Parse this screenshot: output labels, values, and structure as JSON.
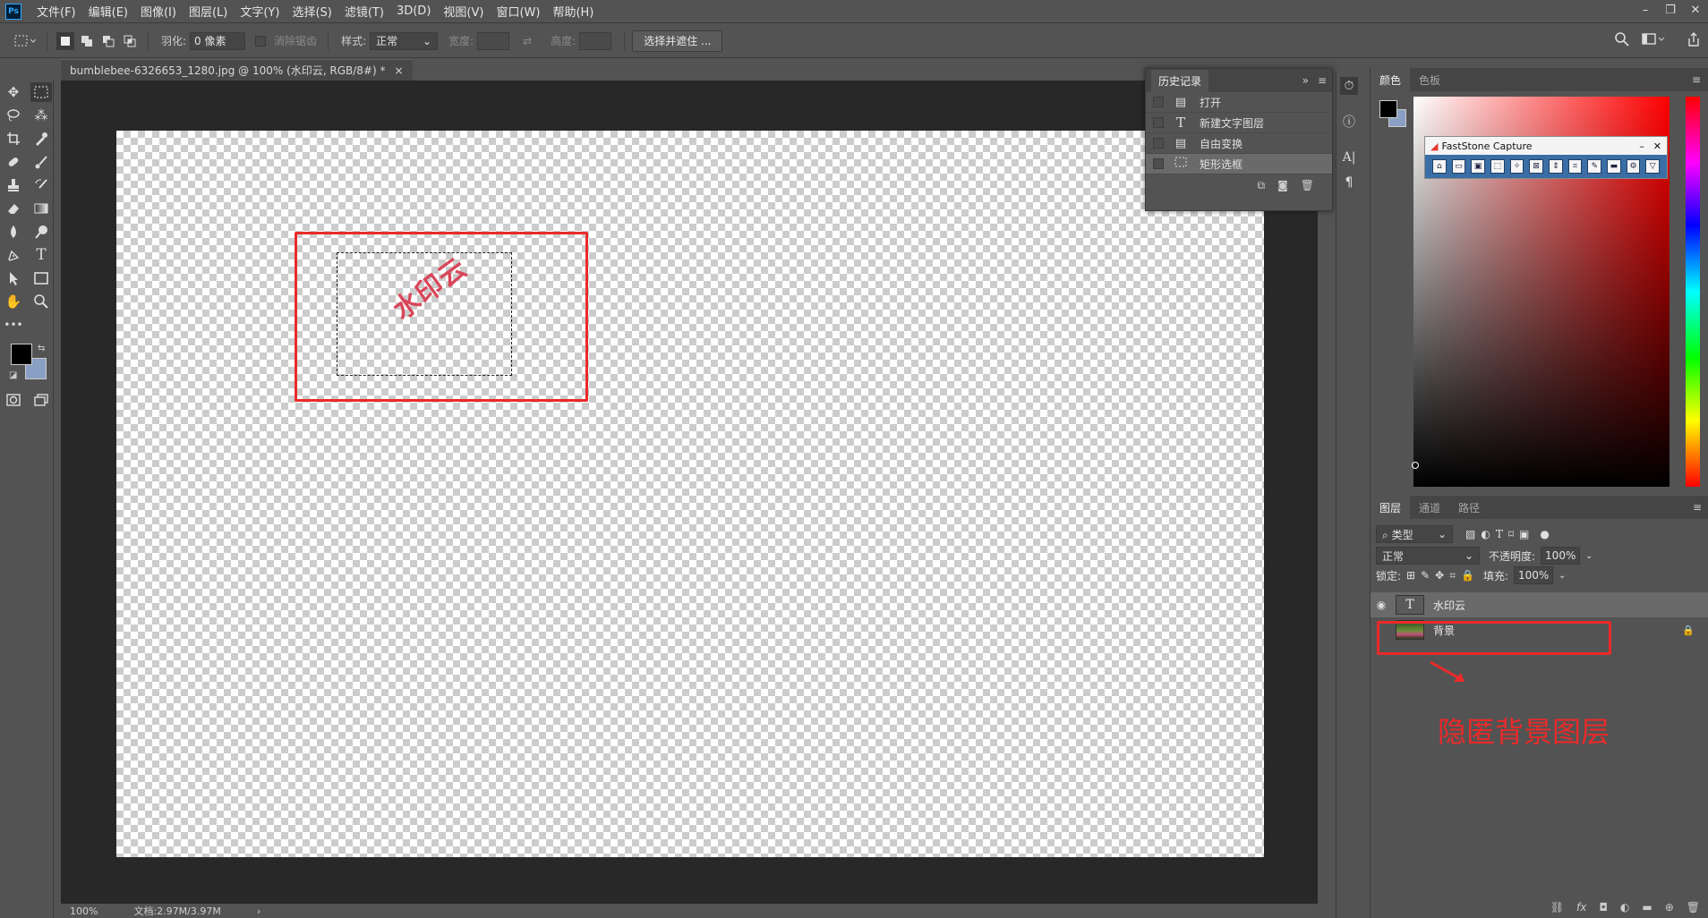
{
  "app": {
    "logo": "Ps"
  },
  "menu": [
    "文件(F)",
    "编辑(E)",
    "图像(I)",
    "图层(L)",
    "文字(Y)",
    "选择(S)",
    "滤镜(T)",
    "3D(D)",
    "视图(V)",
    "窗口(W)",
    "帮助(H)"
  ],
  "window_controls": {
    "minimize": "–",
    "restore": "❐",
    "close": "✕"
  },
  "options": {
    "feather_label": "羽化:",
    "feather_value": "0 像素",
    "antialias_label": "消除锯齿",
    "style_label": "样式:",
    "style_value": "正常",
    "width_label": "宽度:",
    "height_label": "高度:",
    "select_mask_button": "选择并遮住 ..."
  },
  "document": {
    "tab_title": "bumblebee-6326653_1280.jpg @ 100% (水印云, RGB/8#) *",
    "close": "×",
    "watermark_text": "水印云"
  },
  "status": {
    "zoom": "100%",
    "doc_info": "文档:2.97M/3.97M",
    "arrow": "›"
  },
  "history": {
    "title": "历史记录",
    "items": [
      {
        "label": "打开",
        "icon": "document-icon"
      },
      {
        "label": "新建文字图层",
        "icon": "text-icon"
      },
      {
        "label": "自由变换",
        "icon": "document-icon"
      },
      {
        "label": "矩形选框",
        "icon": "marquee-icon"
      }
    ]
  },
  "color_panel": {
    "tabs": [
      "颜色",
      "色板"
    ]
  },
  "faststone": {
    "title": "FastStone Capture"
  },
  "layers_panel": {
    "tabs": [
      "图层",
      "通道",
      "路径"
    ],
    "filter_kind": "类型",
    "blend_mode": "正常",
    "opacity_label": "不透明度:",
    "opacity_value": "100%",
    "lock_label": "锁定:",
    "fill_label": "填充:",
    "fill_value": "100%",
    "layers": [
      {
        "name": "水印云",
        "type": "text",
        "visible": true,
        "selected": true
      },
      {
        "name": "背景",
        "type": "image",
        "visible": false,
        "locked": true
      }
    ]
  },
  "annotation": {
    "text": "隐匿背景图层",
    "color": "#ea2a2a"
  }
}
